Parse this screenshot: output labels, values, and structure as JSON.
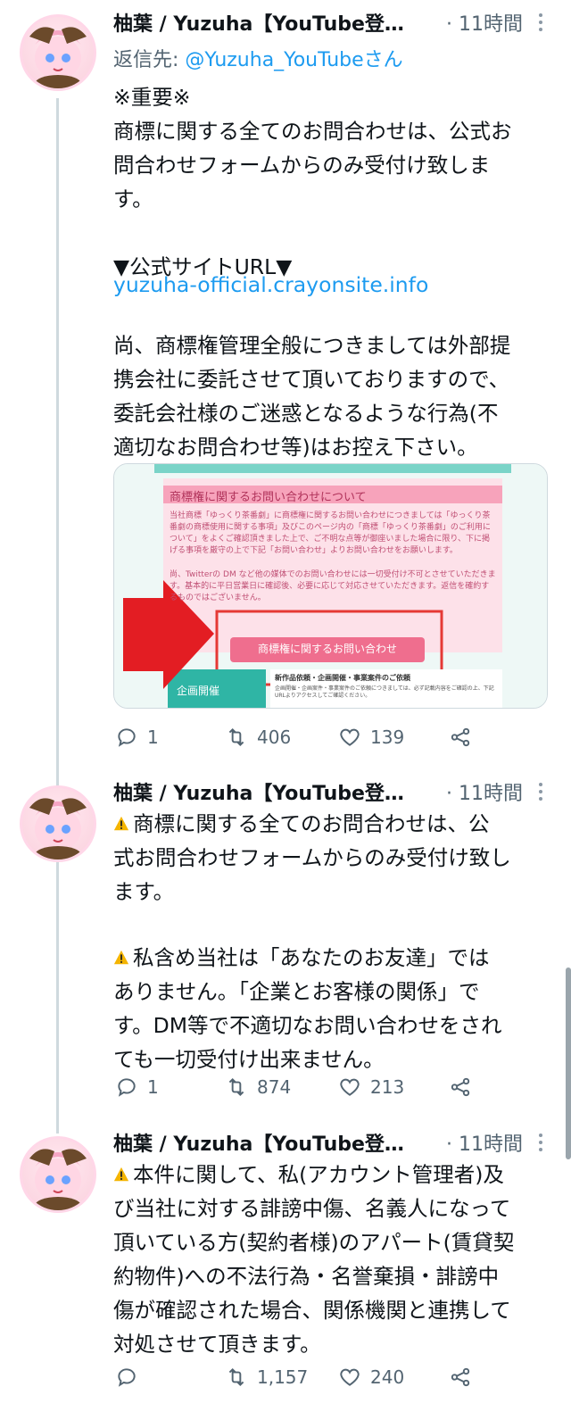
{
  "tweets": [
    {
      "name": "柚葉 / Yuzuha【YouTube登…",
      "time": "· 11時間",
      "reply_prefix": "返信先: ",
      "reply_handle": "@Yuzuha_YouTubeさん",
      "text": "※重要※\n商標に関する全てのお問合わせは、公式お\n問合わせフォームからのみ受付け致しま\nす。\n\n▼公式サイトURL▼",
      "link": "yuzuha-official.crayonsite.info",
      "text2": "尚、商標権管理全般につきましては外部提\n携会社に委託させて頂いておりますので、\n委託会社様のご迷惑となるような行為(不\n適切なお問合わせ等)はお控え下さい。",
      "media": {
        "heading": "商標権に関するお問い合わせについて",
        "para1": "当社商標「ゆっくり茶番劇」に商標権に関するお問い合わせにつきましては「ゆっくり茶番劇の商標使用に関する事項」及びこのページ内の「商標「ゆっくり茶番劇」のご利用について」をよくご確認頂きました上で、ご不明な点等が御座いました場合に限り、下に掲げる事項を厳守の上で下記「お問い合わせ」よりお問い合わせをお願いします。",
        "para2": "尚、Twitterの DM など他の媒体でのお問い合わせには一切受付け不可とさせていただきます。基本的に平日営業日に確認後、必要に応じて対応させていただきます。返信を確約するものではございません。",
        "button": "商標権に関するお問い合わせ",
        "footer_left": "企画開催",
        "footer_title": "新作品依頼・企画開催・事業案件のご依頼",
        "footer_small": "企画開催・企画案件・事業案件のご依頼につきましては、必ず記載内容をご確認の上、下記URLよりアクセスしてご確認ください。"
      },
      "replies": "1",
      "retweets": "406",
      "likes": "139"
    },
    {
      "name": "柚葉 / Yuzuha【YouTube登…",
      "time": "· 11時間",
      "text": "商標に関する全てのお問合わせは、公\n式お問合わせフォームからのみ受付け致し\nます。",
      "text2": "私含め当社は「あなたのお友達」では\nありません。「企業とお客様の関係」で\nす。DM等で不適切なお問い合わせをされ\nても一切受付け出来ません。",
      "replies": "1",
      "retweets": "874",
      "likes": "213"
    },
    {
      "name": "柚葉 / Yuzuha【YouTube登…",
      "time": "· 11時間",
      "text": "本件に関して、私(アカウント管理者)及\nび当社に対する誹謗中傷、名義人になって\n頂いている方(契約者様)のアパート(賃貸契\n約物件)への不法行為・名誉棄損・誹謗中\n傷が確認された場合、関係機関と連携して\n対処させて頂きます。",
      "replies": "",
      "retweets": "1,157",
      "likes": "240"
    }
  ],
  "colors": {
    "link": "#1d9bf0",
    "muted": "#536471",
    "warning": "#f4b400",
    "arrow": "#e31d23"
  },
  "icons": [
    "reply-icon",
    "retweet-icon",
    "like-icon",
    "share-icon",
    "more-icon",
    "warning-icon",
    "avatar"
  ]
}
